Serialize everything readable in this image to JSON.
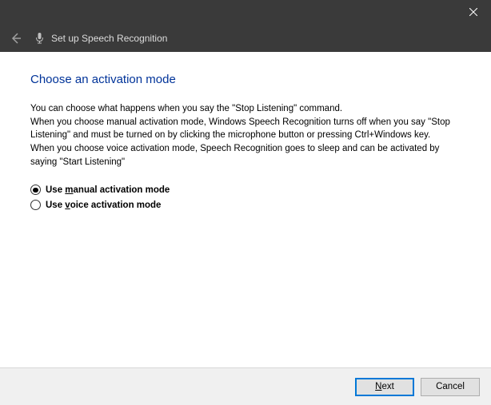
{
  "window": {
    "title": "Set up Speech Recognition"
  },
  "page": {
    "heading": "Choose an activation mode",
    "description": "You can choose what happens when you say the \"Stop Listening\" command.\nWhen you choose manual activation mode, Windows Speech Recognition turns off when you say \"Stop Listening\" and must be turned on by clicking the microphone button or pressing Ctrl+Windows key.\nWhen you choose voice activation mode, Speech Recognition goes to sleep and can be activated by saying \"Start Listening\""
  },
  "options": {
    "manual": {
      "prefix": "Use ",
      "key": "m",
      "suffix": "anual activation mode",
      "selected": true
    },
    "voice": {
      "prefix": "Use ",
      "key": "v",
      "suffix": "oice activation mode",
      "selected": false
    }
  },
  "buttons": {
    "next": {
      "key": "N",
      "suffix": "ext"
    },
    "cancel": {
      "label": "Cancel"
    }
  }
}
